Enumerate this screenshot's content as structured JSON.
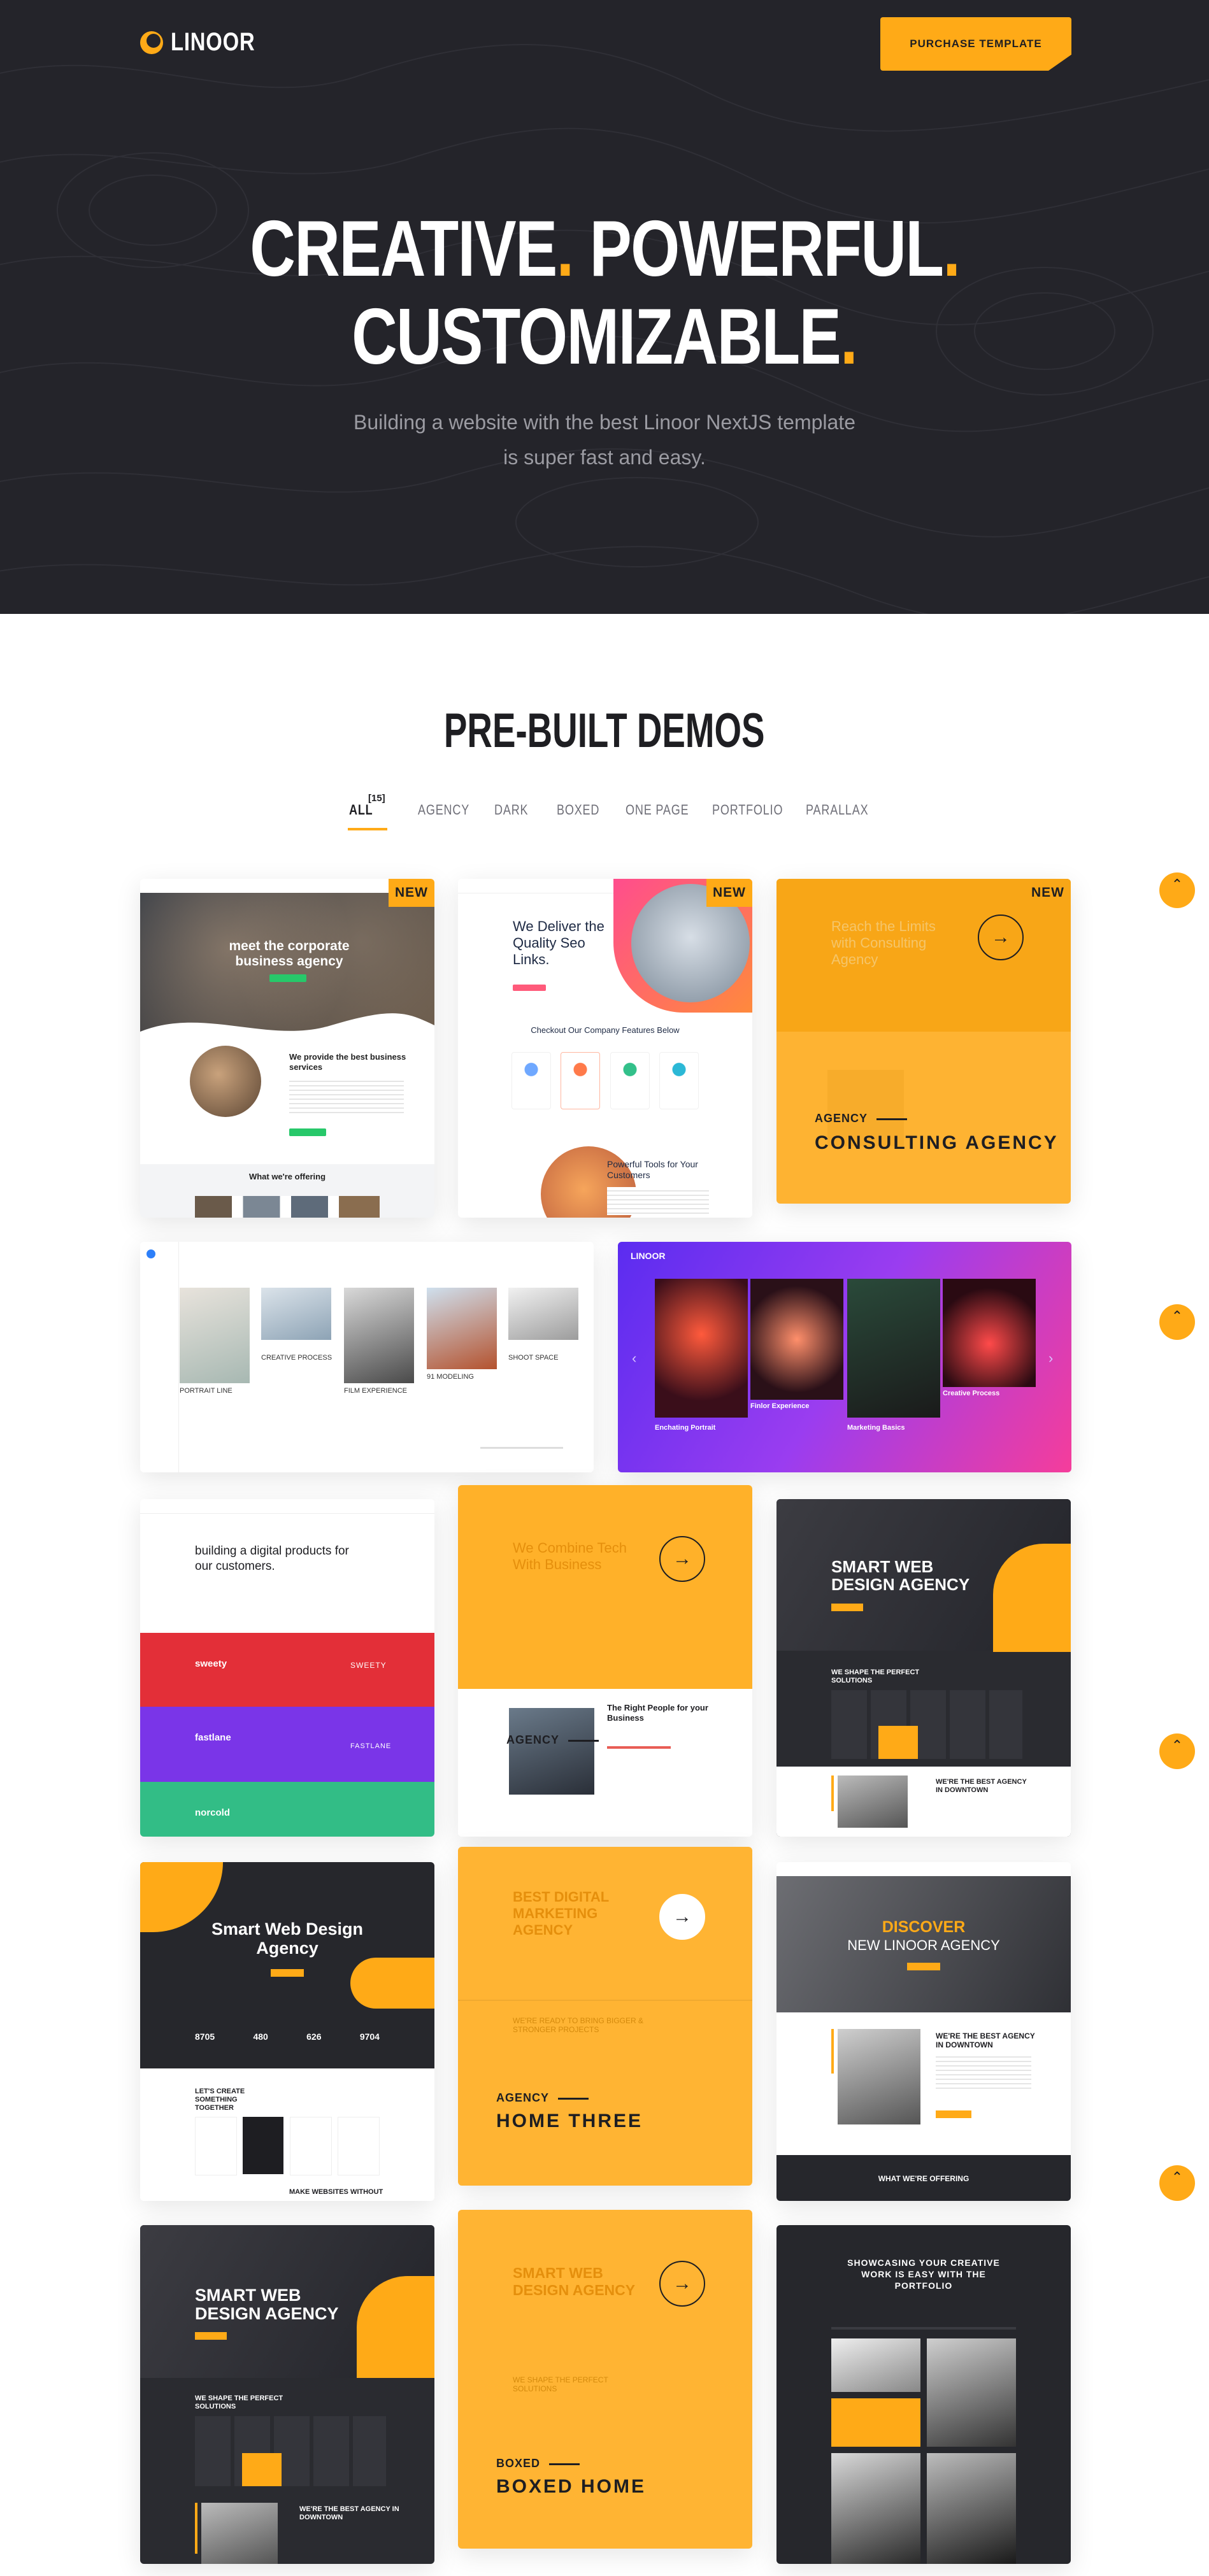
{
  "brand": {
    "name": "LINOOR",
    "accent": "#ffaa17",
    "dark": "#24242a"
  },
  "header": {
    "purchase_label": "PURCHASE TEMPLATE"
  },
  "hero": {
    "line1_a": "CREATIVE",
    "line1_b": "POWERFUL",
    "line2": "CUSTOMIZABLE",
    "dot": ".",
    "subtitle": "Building a website with the best Linoor NextJS template is super fast and easy."
  },
  "demos": {
    "title": "PRE-BUILT DEMOS",
    "filters": [
      {
        "label": "ALL",
        "count": "[15]",
        "active": true
      },
      {
        "label": "AGENCY"
      },
      {
        "label": "DARK"
      },
      {
        "label": "BOXED"
      },
      {
        "label": "ONE PAGE"
      },
      {
        "label": "PORTFOLIO"
      },
      {
        "label": "PARALLAX"
      }
    ],
    "badge_new": "NEW",
    "cards": {
      "c1": {
        "hero_text": "meet the corporate business agency",
        "sub_heading": "We provide the best business services",
        "section": "What we're offering"
      },
      "c2": {
        "hero_text": "We Deliver the Quality Seo Links.",
        "features": "Checkout Our Company Features Below",
        "tools": "Powerful Tools for Your Customers"
      },
      "c3": {
        "category": "AGENCY",
        "title": "CONSULTING AGENCY",
        "bg_text": "Reach the Limits with Consulting Agency"
      },
      "c4": {
        "items": [
          "PORTRAIT LINE",
          "CREATIVE PROCESS",
          "FILM EXPERIENCE",
          "91 MODELING",
          "SHOOT SPACE"
        ]
      },
      "c5": {
        "logo": "LINOOR",
        "items": [
          "Enchating Portrait",
          "Finlor Experience",
          "Marketing Basics",
          "Creative Process"
        ]
      },
      "c6": {
        "hero_text": "building a digital products for our customers.",
        "bands": [
          "sweety",
          "fastlane",
          "norcold"
        ],
        "band_logos": [
          "SWEETY",
          "FASTLANE"
        ]
      },
      "c7": {
        "category": "AGENCY",
        "bg_text": "We Combine Tech With Business",
        "sub_text": "The Right People for your Business"
      },
      "c8": {
        "hero_text": "SMART WEB DESIGN AGENCY",
        "shape_text": "WE SHAPE THE PERFECT SOLUTIONS",
        "best_text": "WE'RE THE BEST AGENCY IN DOWNTOWN"
      },
      "c9": {
        "hero_text": "Smart Web Design Agency",
        "stats": [
          "8705",
          "480",
          "626",
          "9704"
        ],
        "create_text": "LET'S CREATE SOMETHING TOGETHER",
        "bottom_text": "MAKE WEBSITES WITHOUT"
      },
      "c10": {
        "category": "AGENCY",
        "title": "HOME THREE",
        "bg_text": "BEST DIGITAL MARKETING AGENCY",
        "sub_text": "WE'RE READY TO BRING BIGGER & STRONGER PROJECTS"
      },
      "c11": {
        "hero_text": "DISCOVER",
        "hero_text2": "NEW LINOOR AGENCY",
        "best_text": "WE'RE THE BEST AGENCY IN DOWNTOWN",
        "section": "WHAT WE'RE OFFERING"
      },
      "c12": {
        "hero_text": "SMART WEB DESIGN AGENCY",
        "shape_text": "WE SHAPE THE PERFECT SOLUTIONS",
        "best_text": "WE'RE THE BEST AGENCY IN DOWNTOWN"
      },
      "c13": {
        "category": "BOXED",
        "title": "BOXED HOME",
        "bg_text": "SMART WEB DESIGN AGENCY",
        "sub_text": "WE SHAPE THE PERFECT SOLUTIONS"
      },
      "c14": {
        "hero_text": "SHOWCASING YOUR CREATIVE WORK IS EASY WITH THE PORTFOLIO"
      }
    }
  },
  "scroll_up_icon": "chevron-up-icon"
}
